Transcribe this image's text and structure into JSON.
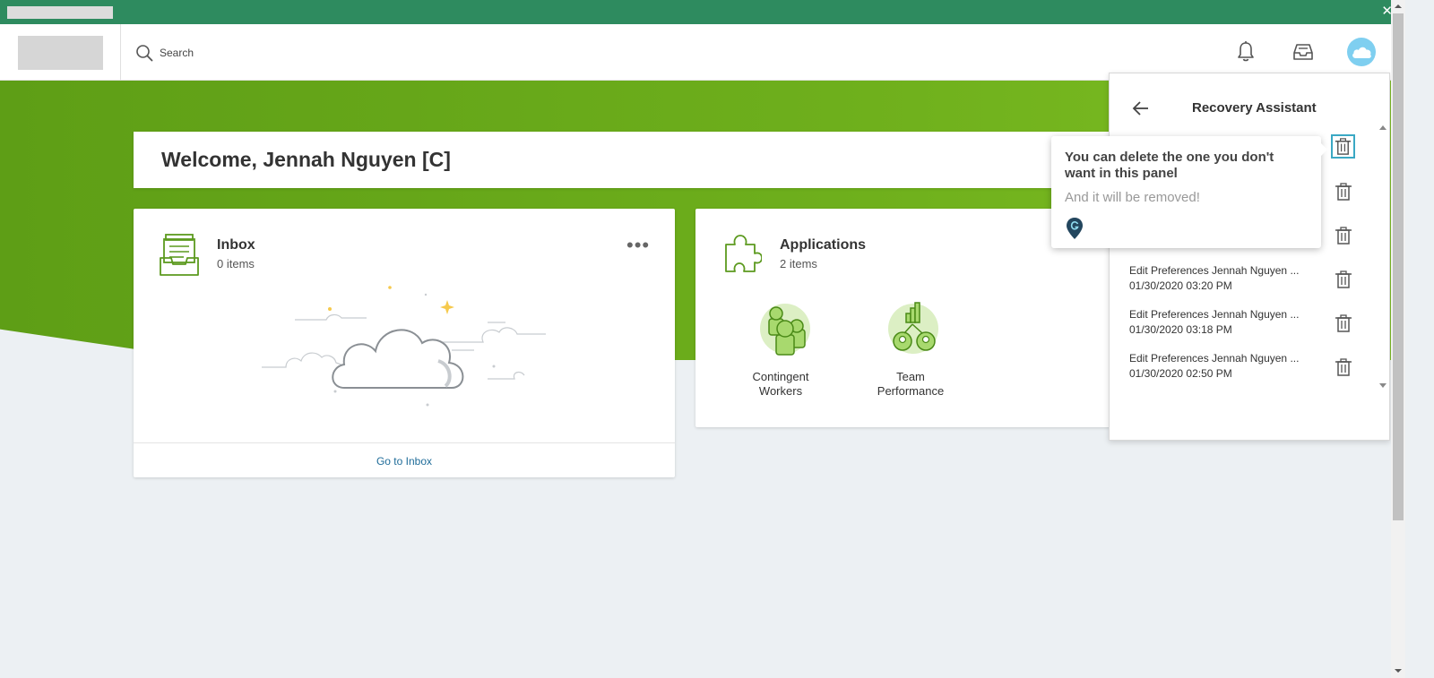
{
  "window": {
    "close_glyph": "✕"
  },
  "header": {
    "search_placeholder": "Search",
    "icons": [
      "search-icon",
      "bell-icon",
      "inbox-tray-icon",
      "cloud-avatar-icon"
    ]
  },
  "welcome": {
    "text": "Welcome, Jennah Nguyen [C]"
  },
  "inbox": {
    "title": "Inbox",
    "count": "0 items",
    "more": "•••",
    "footer_link": "Go to Inbox"
  },
  "applications": {
    "title": "Applications",
    "count": "2 items",
    "tiles": [
      {
        "label": "Contingent Workers"
      },
      {
        "label": "Team Performance"
      }
    ]
  },
  "recovery_panel": {
    "title": "Recovery Assistant",
    "items": [
      {
        "name": "Edit Preferences Jennah Nguyen ...",
        "date": "01/30/2020 03:20 PM"
      },
      {
        "name": "Edit Preferences Jennah Nguyen ...",
        "date": "01/30/2020 03:18 PM"
      },
      {
        "name": "Edit Preferences Jennah Nguyen ...",
        "date": "01/30/2020 02:50 PM"
      }
    ]
  },
  "tooltip": {
    "title": "You can delete the one you don't want in this panel",
    "body": "And it will be removed!"
  },
  "colors": {
    "topbar": "#2e8b5f",
    "hero_green": "#6eaf1c",
    "icon_green": "#5c9a1f",
    "link": "#1f6c99",
    "focus": "#3aa8c4",
    "avatar": "#7fcff0"
  }
}
